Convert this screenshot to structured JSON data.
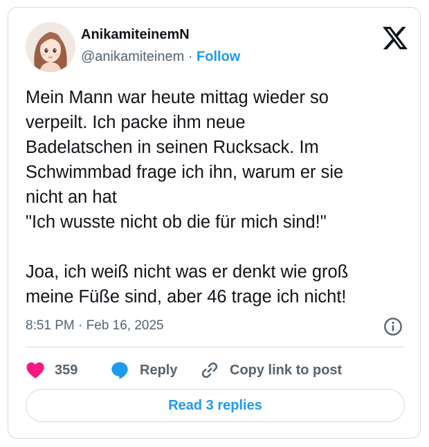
{
  "author": {
    "display_name": "AnikamiteinemN",
    "handle": "@anikamiteinem",
    "separator": "·",
    "follow_label": "Follow"
  },
  "logo": {
    "icon": "x-logo-icon"
  },
  "tweet": {
    "text": "Mein Mann war heute mittag wieder so\nverpeilt. Ich packe ihm neue\nBadelatschen in seinen Rucksack. Im\nSchwimmbad frage ich ihn, warum er sie\nnicht an hat\n\"Ich wusste nicht ob die für mich sind!\"\n\nJoa, ich weiß nicht was er denkt wie groß\nmeine Füße sind, aber 46 trage ich nicht!",
    "timestamp": "8:51 PM · Feb 16, 2025"
  },
  "actions": {
    "like_count": "359",
    "reply_label": "Reply",
    "copy_label": "Copy link to post"
  },
  "read_replies_label": "Read 3 replies",
  "colors": {
    "accent": "#1d9bf0",
    "like": "#f91880",
    "text": "#0f1419",
    "muted": "#536471",
    "border": "#cfd9de"
  }
}
